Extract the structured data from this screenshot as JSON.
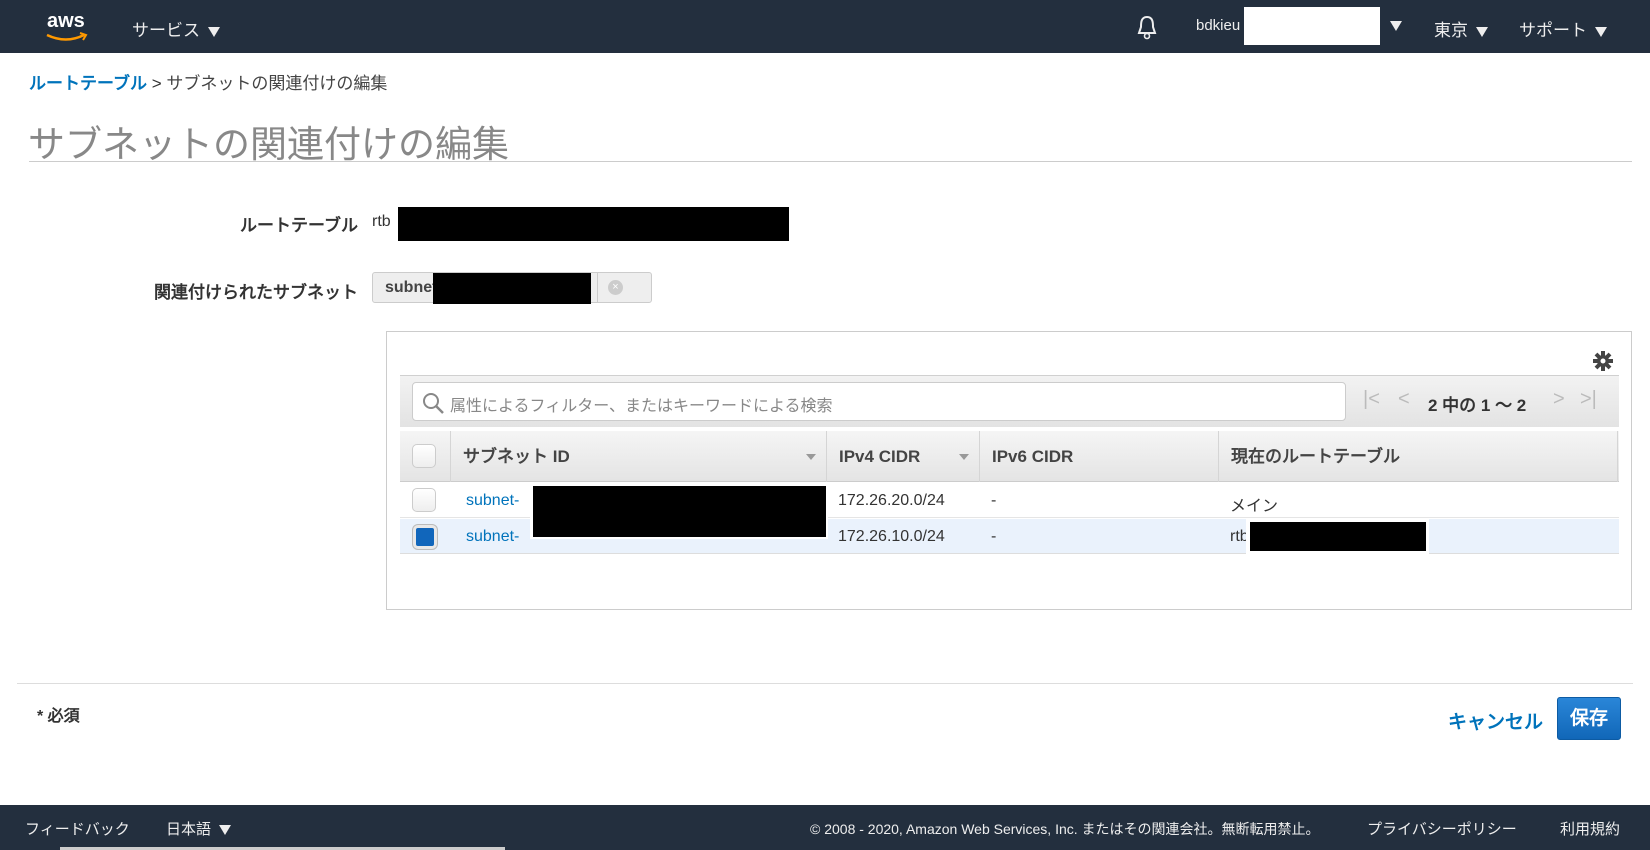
{
  "topbar": {
    "logo": "aws",
    "services": "サービス",
    "username": "bdkieu",
    "region": "東京",
    "support": "サポート"
  },
  "breadcrumb": {
    "parent": "ルートテーブル",
    "separator": ">",
    "current": "サブネットの関連付けの編集"
  },
  "page_title": "サブネットの関連付けの編集",
  "form": {
    "route_table_label": "ルートテーブル",
    "route_table_prefix": "rtb",
    "subnets_label": "関連付けられたサブネット",
    "subnet_token": "subnet"
  },
  "table": {
    "search_placeholder": "属性によるフィルター、またはキーワードによる検索",
    "pagination": "2 中の 1 ～ 2",
    "columns": [
      "サブネット ID",
      "IPv4 CIDR",
      "IPv6 CIDR",
      "現在のルートテーブル"
    ],
    "rows": [
      {
        "subnet": "subnet-",
        "ipv4": "172.26.20.0/24",
        "ipv6": "-",
        "route_table": "メイン",
        "checked": false
      },
      {
        "subnet": "subnet-",
        "ipv4": "172.26.10.0/24",
        "ipv6": "-",
        "route_table": "rtb-",
        "checked": true
      }
    ]
  },
  "actions": {
    "required_note": "* 必須",
    "cancel": "キャンセル",
    "save": "保存"
  },
  "footer": {
    "feedback": "フィードバック",
    "language": "日本語",
    "copyright": "© 2008 - 2020, Amazon Web Services, Inc. またはその関連会社。無断転用禁止。",
    "privacy": "プライバシーポリシー",
    "terms": "利用規約"
  }
}
